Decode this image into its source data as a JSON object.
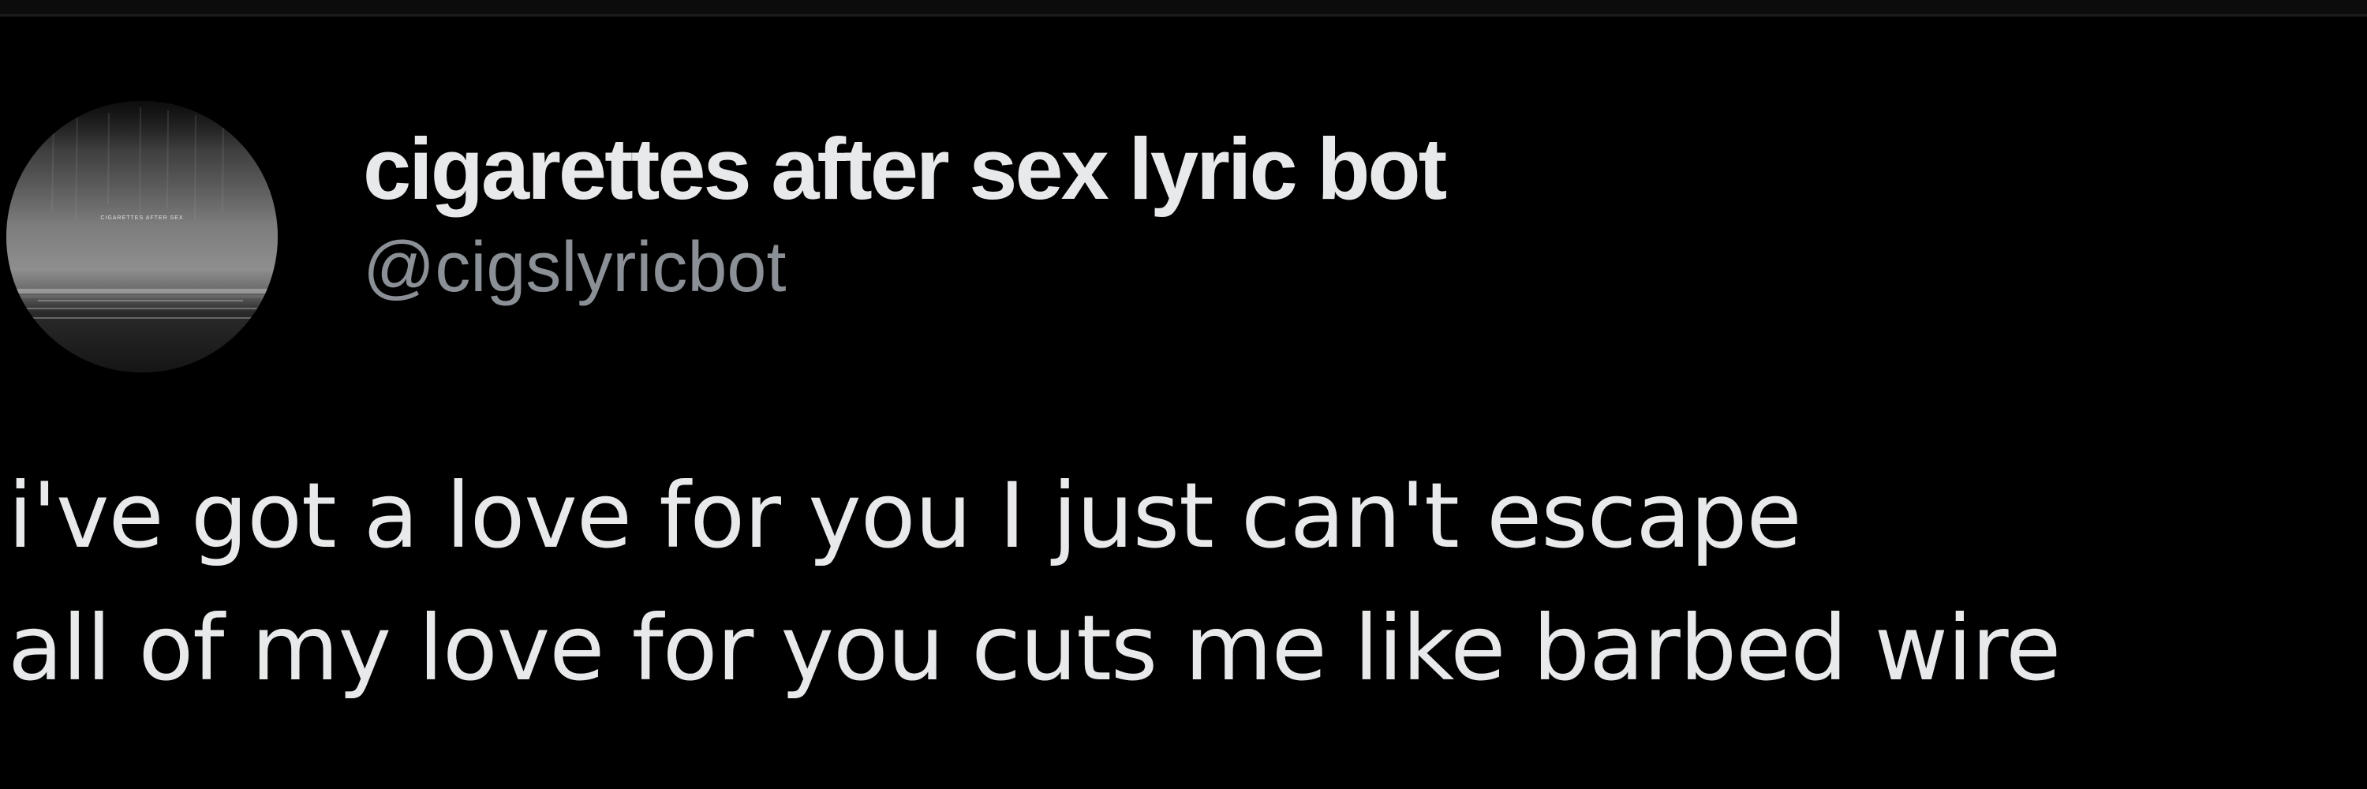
{
  "tweet": {
    "avatar_icon": "album-cover-avatar-icon",
    "avatar_caption": "CIGARETTES AFTER SEX",
    "display_name": "cigarettes after sex lyric bot",
    "handle": "@cigslyricbot",
    "text_lines": [
      "i've got a love for you I just can't escape",
      "all of my love for you cuts me like barbed wire"
    ]
  },
  "colors": {
    "background": "#000000",
    "text_primary": "#e7e9ea",
    "text_secondary": "#8b9096"
  }
}
